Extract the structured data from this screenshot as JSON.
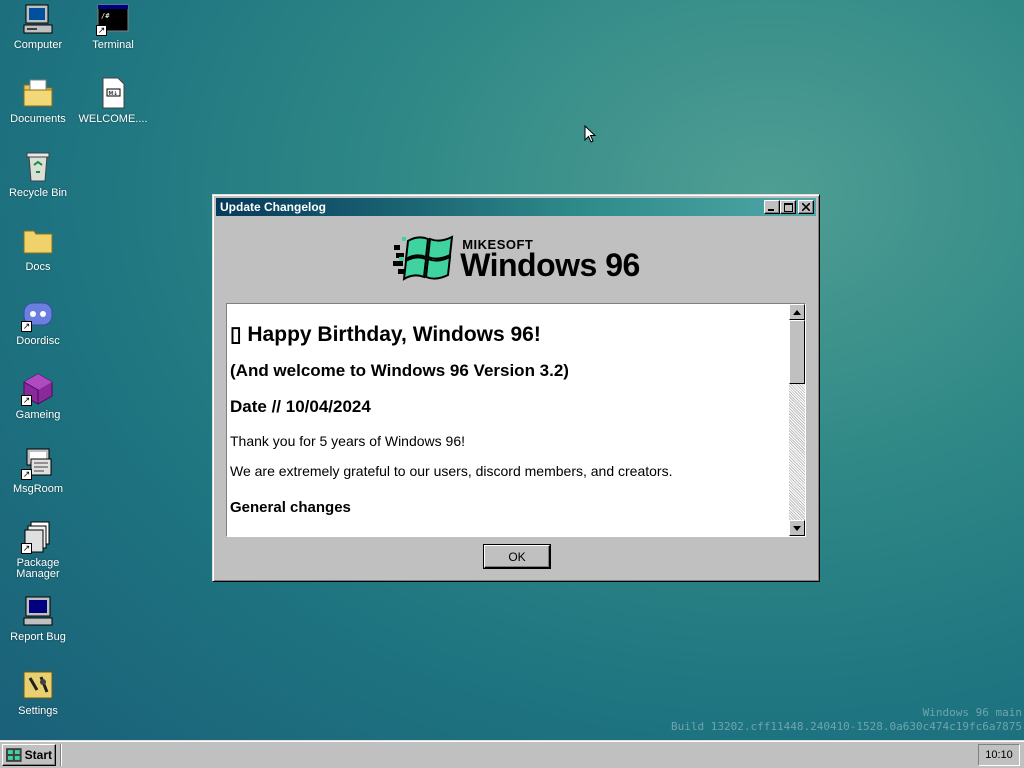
{
  "desktop": {
    "icons": [
      {
        "label": "Computer",
        "icon": "computer-icon",
        "shortcut": false
      },
      {
        "label": "Terminal",
        "icon": "terminal-icon",
        "shortcut": true
      },
      {
        "label": "Documents",
        "icon": "documents-folder-icon",
        "shortcut": false
      },
      {
        "label": "WELCOME....",
        "icon": "markdown-file-icon",
        "shortcut": false
      },
      {
        "label": "Recycle Bin",
        "icon": "recycle-bin-icon",
        "shortcut": false
      },
      {
        "label": "Docs",
        "icon": "folder-icon",
        "shortcut": false
      },
      {
        "label": "Doordisc",
        "icon": "doordisc-icon",
        "shortcut": true
      },
      {
        "label": "Gameing",
        "icon": "gameing-icon",
        "shortcut": true
      },
      {
        "label": "MsgRoom",
        "icon": "msgroom-icon",
        "shortcut": true
      },
      {
        "label": "Package Manager",
        "icon": "package-manager-icon",
        "shortcut": true
      },
      {
        "label": "Report Bug",
        "icon": "report-bug-icon",
        "shortcut": false
      },
      {
        "label": "Settings",
        "icon": "settings-icon",
        "shortcut": false
      }
    ],
    "watermark_line1": "Windows 96 main",
    "watermark_line2": "Build 13202.cff11448.240410-1528.0a630c474c19fc6a7875"
  },
  "window": {
    "title": "Update Changelog",
    "logo_small": "MIKESOFT",
    "logo_big": "Windows 96",
    "heading": "▯ Happy Birthday, Windows 96!",
    "subheading": "(And welcome to Windows 96 Version 3.2)",
    "date": "Date // 10/04/2024",
    "para1": "Thank you for 5 years of Windows 96!",
    "para2": "We are extremely grateful to our users, discord members, and creators.",
    "section1": "General changes",
    "ok_label": "OK",
    "colors": {
      "titlebar_start": "#063a5a",
      "titlebar_end": "#4fa7a7",
      "logo_green": "#3fd3a0"
    }
  },
  "taskbar": {
    "start_label": "Start",
    "clock": "10:10"
  }
}
